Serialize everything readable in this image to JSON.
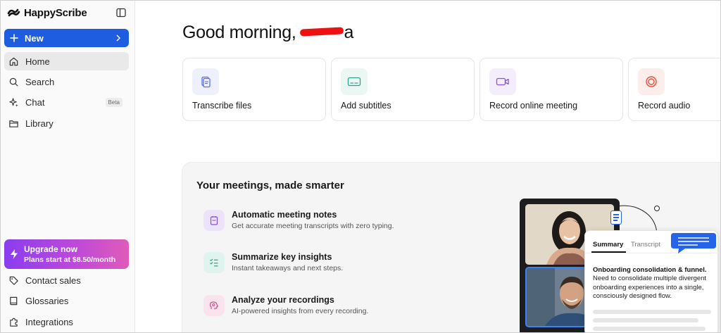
{
  "sidebar": {
    "brand": "HappyScribe",
    "new_label": "New",
    "nav": [
      {
        "label": "Home",
        "icon": "home-icon"
      },
      {
        "label": "Search",
        "icon": "search-icon"
      },
      {
        "label": "Chat",
        "icon": "sparkle-icon",
        "badge": "Beta"
      },
      {
        "label": "Library",
        "icon": "folder-icon"
      }
    ],
    "upgrade": {
      "title": "Upgrade now",
      "subtitle": "Plans start at $8.50/month"
    },
    "bottom_nav": [
      {
        "label": "Contact sales",
        "icon": "tag-icon"
      },
      {
        "label": "Glossaries",
        "icon": "book-icon"
      },
      {
        "label": "Integrations",
        "icon": "puzzle-icon"
      }
    ]
  },
  "main": {
    "greeting": "Good morning,",
    "greeting_tail": "a",
    "actions": [
      {
        "label": "Transcribe files",
        "icon": "document-icon",
        "color": "#5b6ee0"
      },
      {
        "label": "Add subtitles",
        "icon": "subtitles-icon",
        "color": "#2aa58a"
      },
      {
        "label": "Record online meeting",
        "icon": "video-camera-icon",
        "color": "#8a55d8"
      },
      {
        "label": "Record audio",
        "icon": "record-icon",
        "color": "#e5503d"
      }
    ],
    "meetings": {
      "title": "Your meetings, made smarter",
      "features": [
        {
          "title": "Automatic meeting notes",
          "desc": "Get accurate meeting transcripts with zero typing."
        },
        {
          "title": "Summarize key insights",
          "desc": "Instant takeaways and next steps."
        },
        {
          "title": "Analyze your recordings",
          "desc": "AI-powered insights from every recording."
        }
      ]
    },
    "summary_card": {
      "tab_summary": "Summary",
      "tab_transcript": "Transcript",
      "heading": "Onboarding consolidation & funnel.",
      "body": "Need to consolidate multiple divergent onboarding experiences into a single, consciously designed flow."
    }
  },
  "colors": {
    "accent": "#1f5de0",
    "upgrade_from": "#8a3df0",
    "upgrade_to": "#e05bb8"
  }
}
